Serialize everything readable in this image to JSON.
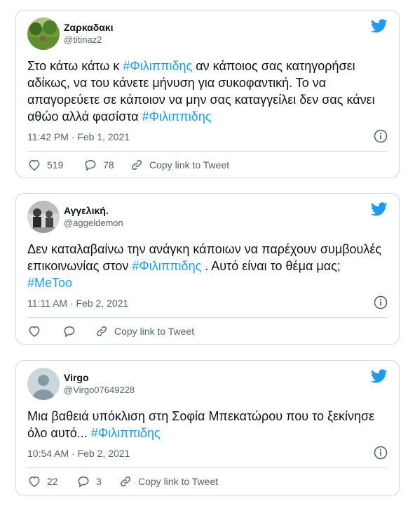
{
  "colors": {
    "link": "#1d9bf0",
    "muted": "#536471",
    "border": "#cfd9de"
  },
  "tweets": [
    {
      "display_name": "Ζαρκαδακι",
      "handle": "@titinaz2",
      "text_a": "Στο κάτω κάτω κ ",
      "tag_a": "#Φιλιππιδης",
      "text_b": " αν κάποιος σας κατηγορήσει αδίκως, να του κάνετε μήνυση για συκοφαντική. Το να απαγορεύετε σε κάποιον να μην σας καταγγείλει δεν σας κάνει αθώο αλλά φασίστα ",
      "tag_b": "#Φιλιππιδης",
      "timestamp": "11:42 PM · Feb 1, 2021",
      "likes": "519",
      "replies": "78",
      "copy_label": "Copy link to Tweet",
      "avatar_icon": "avatar-photo-garden"
    },
    {
      "display_name": "Αγγελική.",
      "handle": "@aggeldemon",
      "text_a": "Δεν καταλαβαίνω την ανάγκη κάποιων να παρέχουν συμβουλές επικοινωνίας στον ",
      "tag_a": "#Φιλιππιδης",
      "text_b": " . Αυτό είναι το θέμα μας; ",
      "tag_b": "#MeToo",
      "timestamp": "11:11 AM · Feb 2, 2021",
      "likes": "",
      "replies": "",
      "copy_label": "Copy link to Tweet",
      "avatar_icon": "avatar-photo-group"
    },
    {
      "display_name": "Virgo",
      "handle": "@Virgo07649228",
      "text_a": "Μια βαθειά υπόκλιση στη Σοφία Μπεκατώρου που το ξεκίνησε όλο αυτό... ",
      "tag_a": "#Φιλιππιδης",
      "text_b": "",
      "tag_b": "",
      "timestamp": "10:54 AM · Feb 2, 2021",
      "likes": "22",
      "replies": "3",
      "copy_label": "Copy link to Tweet",
      "avatar_icon": "default-avatar-icon"
    }
  ]
}
